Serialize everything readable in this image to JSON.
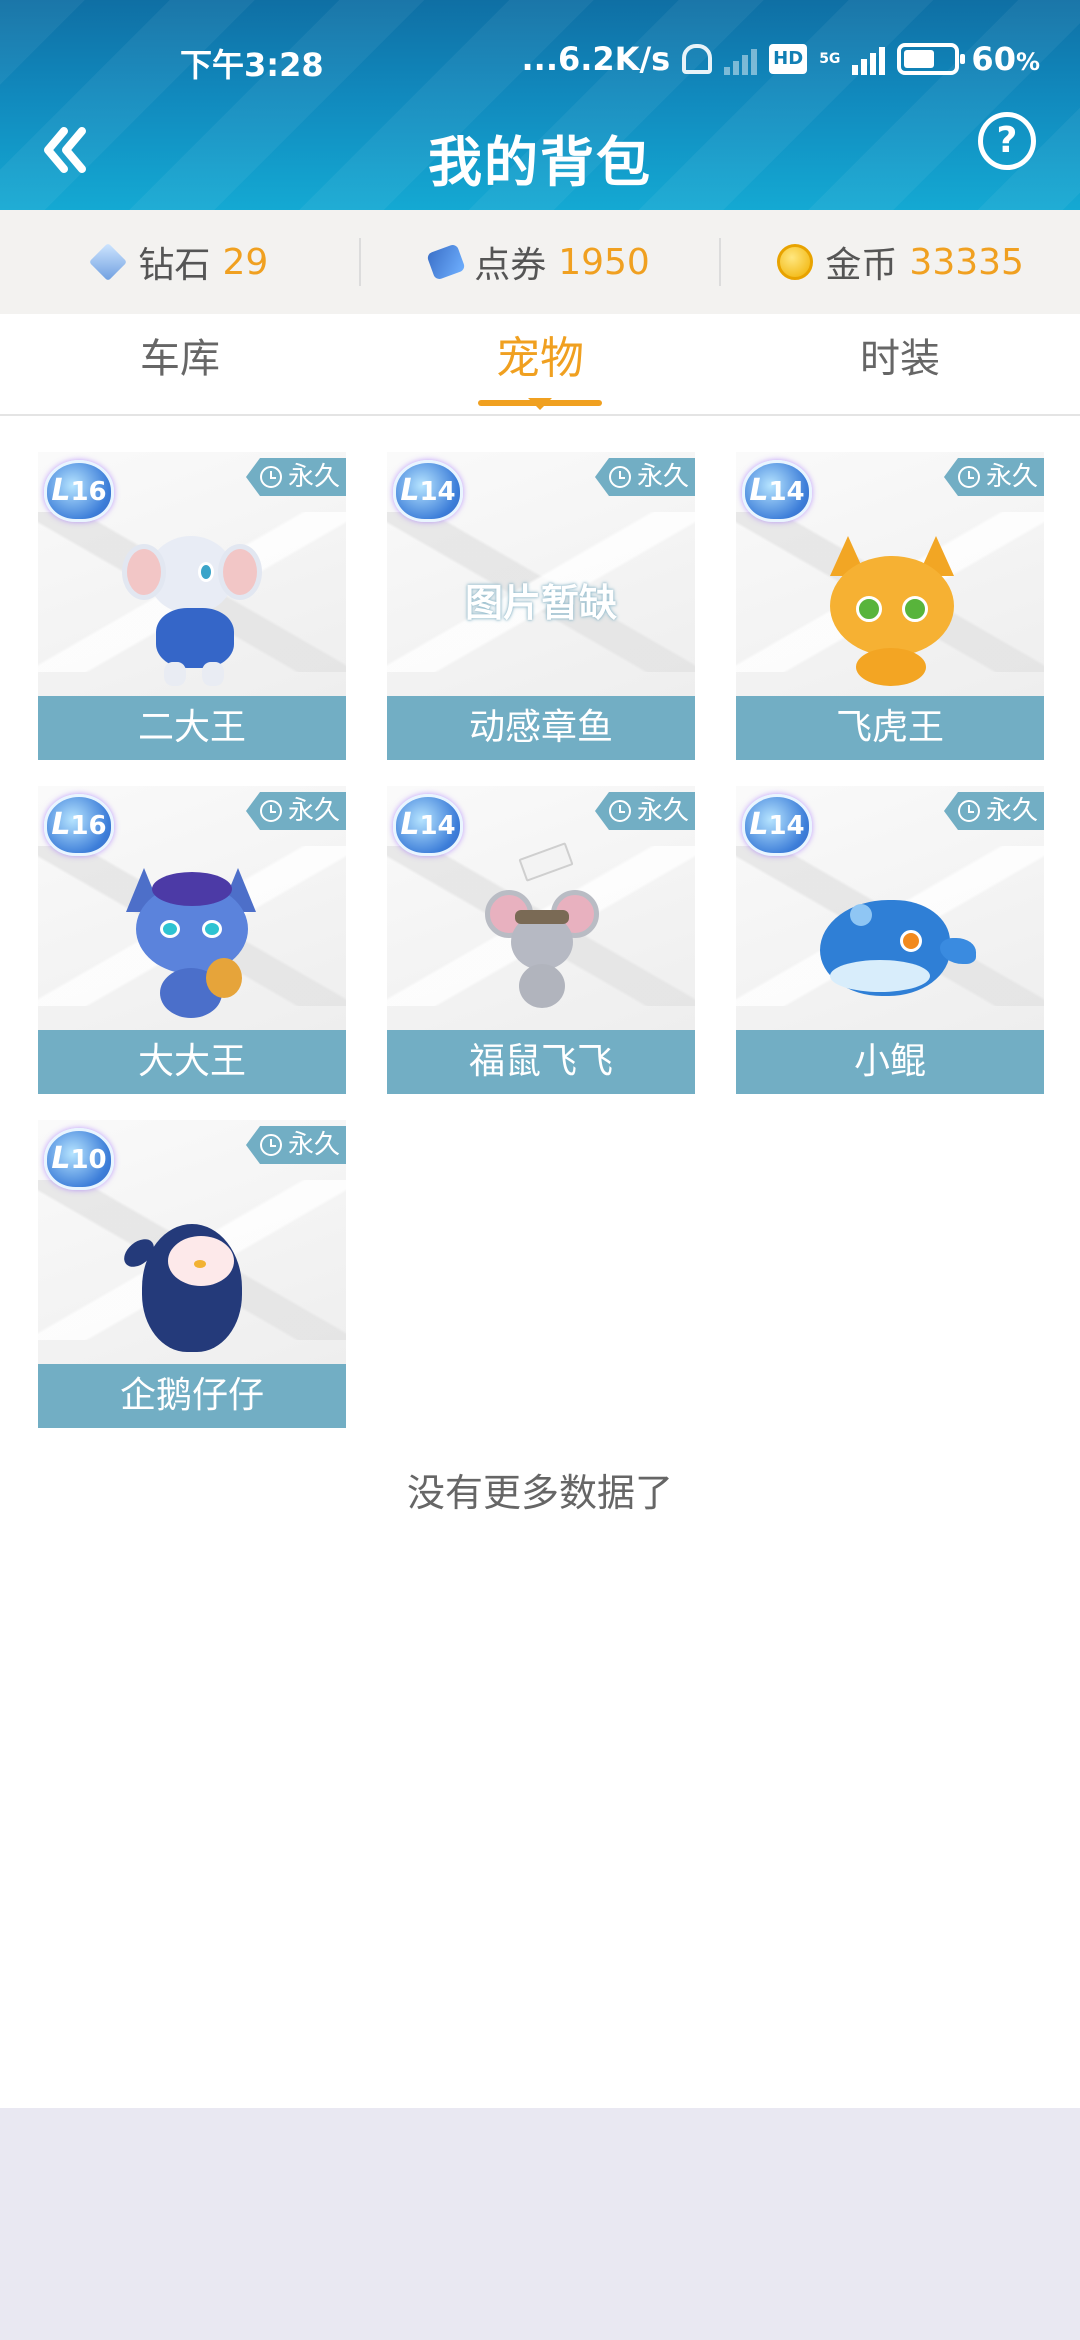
{
  "status_bar": {
    "time": "下午3:28",
    "network_speed": "...6.2K/s",
    "hd": "HD",
    "network_type": "5G",
    "battery": "60",
    "battery_unit": "%",
    "battery_fraction": 0.6
  },
  "header": {
    "title": "我的背包",
    "back_icon": "double-chevron-left-icon",
    "help_icon": "question-circle-icon",
    "help_label": "?"
  },
  "currency": [
    {
      "icon": "diamond-icon",
      "label": "钻石",
      "value": "29"
    },
    {
      "icon": "voucher-icon",
      "label": "点券",
      "value": "1950"
    },
    {
      "icon": "coin-icon",
      "label": "金币",
      "value": "33335"
    }
  ],
  "tabs": [
    {
      "label": "车库",
      "active": false
    },
    {
      "label": "宠物",
      "active": true
    },
    {
      "label": "时装",
      "active": false
    }
  ],
  "pets": [
    {
      "name": "二大王",
      "level": "16",
      "duration": "永久",
      "image": "elephant"
    },
    {
      "name": "动感章鱼",
      "level": "14",
      "duration": "永久",
      "image": "placeholder",
      "placeholder_text": "图片暂缺"
    },
    {
      "name": "飞虎王",
      "level": "14",
      "duration": "永久",
      "image": "tiger"
    },
    {
      "name": "大大王",
      "level": "16",
      "duration": "永久",
      "image": "cat-guitar"
    },
    {
      "name": "福鼠飞飞",
      "level": "14",
      "duration": "永久",
      "image": "mouse"
    },
    {
      "name": "小鲲",
      "level": "14",
      "duration": "永久",
      "image": "whale"
    },
    {
      "name": "企鹅仔仔",
      "level": "10",
      "duration": "永久",
      "image": "penguin"
    }
  ],
  "footer": {
    "no_more": "没有更多数据了"
  },
  "colors": {
    "header": "#1189bd",
    "accent": "#f0a020",
    "name_bar": "#72aec4"
  }
}
